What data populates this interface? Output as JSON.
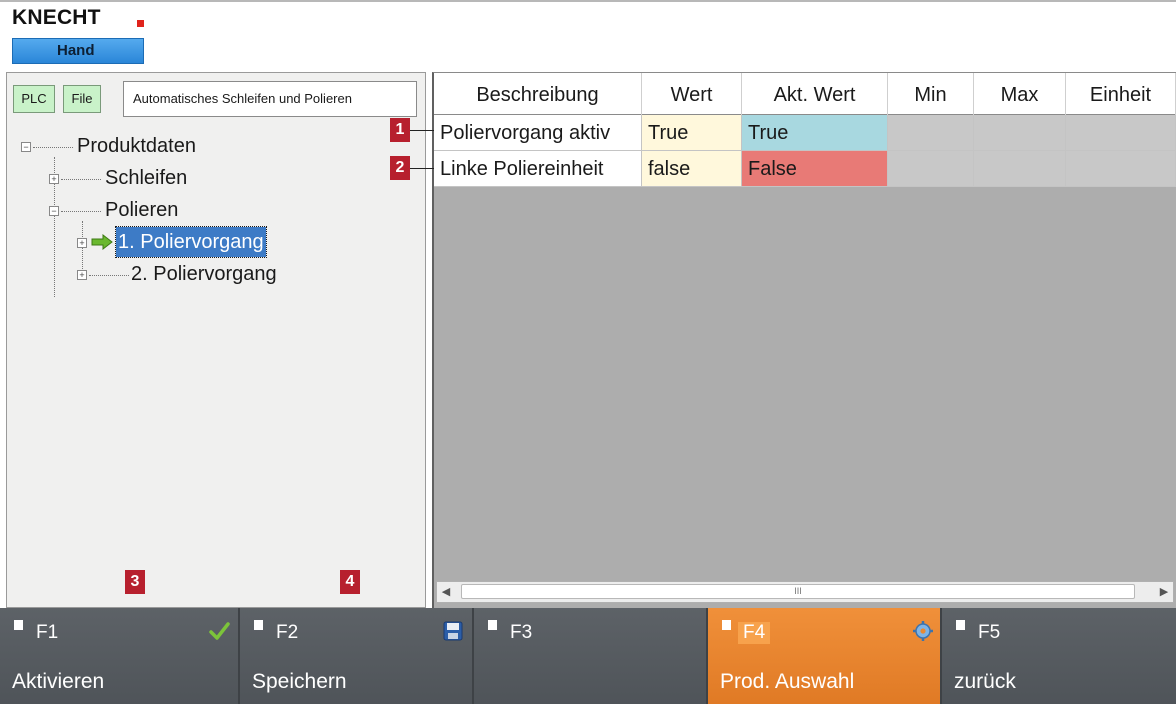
{
  "header": {
    "logo": "KNECHT",
    "mode": "Hand",
    "brand_color": "#e0231b",
    "mode_color": "#3b97e3"
  },
  "toolbar": {
    "plc_label": "PLC",
    "file_label": "File",
    "path": "Automatisches Schleifen und Polieren"
  },
  "tree": {
    "root": "Produktdaten",
    "items": [
      {
        "label": "Schleifen",
        "expander": "+"
      },
      {
        "label": "Polieren",
        "expander": "−"
      },
      {
        "label": "1. Poliervorgang",
        "expander": "+",
        "selected": true,
        "icon": "green-arrow-icon"
      },
      {
        "label": "2. Poliervorgang",
        "expander": "+"
      }
    ],
    "root_expander": "−"
  },
  "grid": {
    "columns": [
      "Beschreibung",
      "Wert",
      "Akt. Wert",
      "Min",
      "Max",
      "Einheit"
    ],
    "rows": [
      {
        "callout": "1",
        "beschreibung": "Poliervorgang aktiv",
        "wert": "True",
        "akt_wert": "True",
        "min": "",
        "max": "",
        "einheit": "",
        "akt_color": "#a8d8e0"
      },
      {
        "callout": "2",
        "beschreibung": "Linke Poliereinheit",
        "wert": "false",
        "akt_wert": "False",
        "min": "",
        "max": "",
        "einheit": "",
        "akt_color": "#e87a76"
      }
    ],
    "scroll_left": "◀",
    "scroll_right": "▶",
    "scroll_grip": "III"
  },
  "callouts": {
    "fkey1": "3",
    "fkey2": "4",
    "color": "#b7202e"
  },
  "fkeys": [
    {
      "id": "F1",
      "label": "Aktivieren",
      "icon": "checkmark-icon"
    },
    {
      "id": "F2",
      "label": "Speichern",
      "icon": "save-icon"
    },
    {
      "id": "F3",
      "label": ""
    },
    {
      "id": "F4",
      "label": "Prod. Auswahl",
      "icon": "gear-icon",
      "active": true,
      "active_color": "#e88a33"
    },
    {
      "id": "F5",
      "label": "zurück"
    }
  ]
}
